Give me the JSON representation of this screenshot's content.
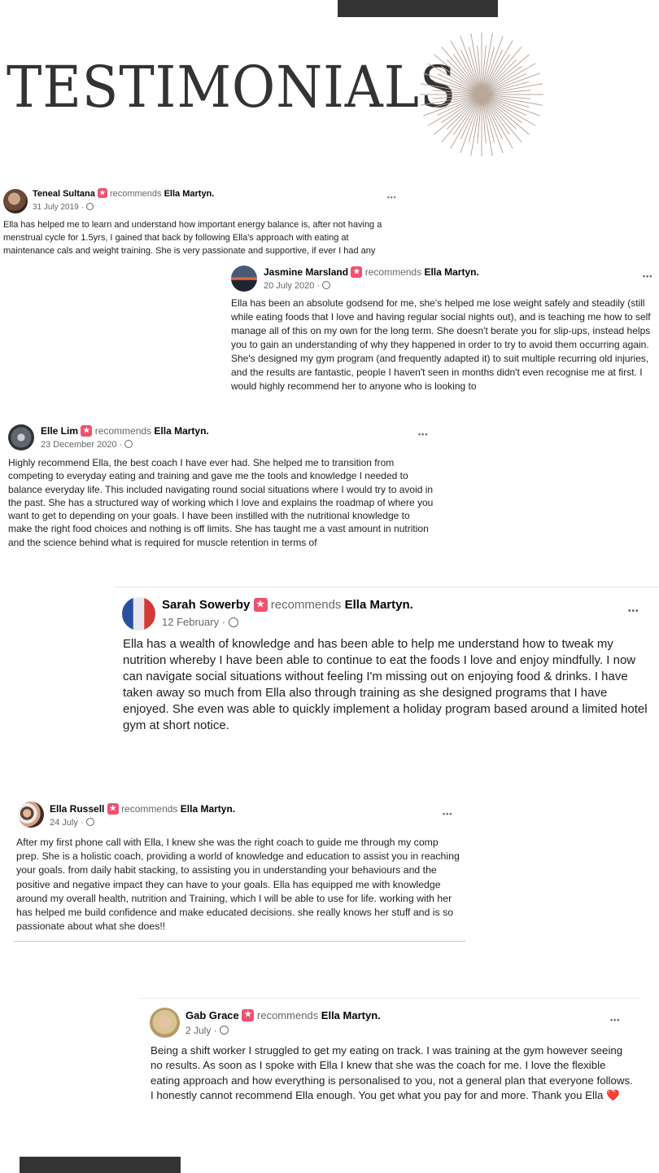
{
  "page": {
    "title": "TESTIMONIALS"
  },
  "common": {
    "recommends": "recommends",
    "coach": "Ella Martyn.",
    "more": "•••"
  },
  "reviews": [
    {
      "name": "Teneal Sultana",
      "date": "31 July 2019 ·",
      "text": "Ella has helped me to learn and understand how important energy balance is, after not having a menstrual cycle for 1.5yrs, I gained that back by following Ella's approach with eating at maintenance cals and weight training. She is very passionate and supportive, if ever I had any"
    },
    {
      "name": "Jasmine Marsland",
      "date": "20 July 2020 ·",
      "text": "Ella has been an absolute godsend for me, she's helped me lose weight safely and steadily (still while eating foods that I love and having regular social nights out), and is teaching me how to self manage all of this on my own for the long term. She doesn't berate you for slip-ups, instead helps you to gain an understanding of why they happened in order to try to avoid them occurring again. She's designed my gym program (and frequently adapted it) to suit multiple recurring old injuries, and the results are fantastic, people I haven't seen in months didn't even recognise me at first. I would highly recommend her to anyone who is looking to"
    },
    {
      "name": "Elle Lim",
      "date": "23 December 2020 ·",
      "text": "Highly recommend Ella, the best coach I have ever had. She helped me to transition from competing to everyday eating and training and gave me the tools and knowledge I needed to balance everyday life. This included navigating round social situations where I would try to avoid in the past. She has a structured way of working which I love and explains the roadmap of where you want to get to depending on your goals. I have been instilled with the nutritional knowledge to make the right food choices and nothing is off limits. She has taught me a vast amount in nutrition and the science behind what is required for muscle retention in terms of"
    },
    {
      "name": "Sarah Sowerby",
      "date": "12 February ·",
      "text": "Ella has a wealth of knowledge and has been able to help me understand how to tweak my nutrition whereby I have been able to continue to eat the foods I love and enjoy mindfully.  I now can navigate social situations without feeling I'm missing out on enjoying food & drinks. I have taken away so much from Ella also through training as she designed programs that I have enjoyed. She even was able to quickly implement a holiday program based around a limited hotel gym at short notice."
    },
    {
      "name": "Ella Russell",
      "date": "24 July ·",
      "text": "After my first phone call with Ella, I knew she was the right coach to guide me through my comp prep. She is a holistic coach, providing a world of knowledge and education to assist you in reaching your goals. from daily habit stacking, to assisting you in understanding your behaviours and the positive and negative impact they can have to your goals. Ella has equipped me with knowledge around my overall health, nutrition and Training, which I will be able to use for life. working with her has helped me build confidence and make educated decisions. she really knows her stuff and is so passionate about what she does!!"
    },
    {
      "name": "Gab Grace",
      "date": "2 July ·",
      "text": "Being a shift worker I struggled to get my eating on track. I was training at the gym however seeing no results. As soon as I spoke with Ella I knew that she was the coach for me. I love the flexible eating approach and how everything is personalised to you, not a general plan that everyone follows. I honestly cannot recommend Ella enough. You get what you pay for and more. Thank you Ella",
      "emoji": "❤️"
    }
  ],
  "colors": {
    "badge": "#f0506e",
    "dark_bar": "#333333",
    "starburst": "#b8a89c"
  },
  "icons": [
    "recommend-badge-icon",
    "globe-icon",
    "more-options-icon",
    "starburst-icon",
    "heart-emoji"
  ]
}
